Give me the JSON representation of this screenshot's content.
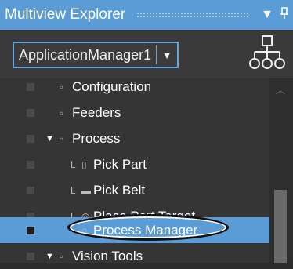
{
  "window": {
    "title": "Multiview Explorer",
    "dropdown_btn": "▼",
    "pin_btn": "ᵾ"
  },
  "toolbar": {
    "selector_value": "ApplicationManager1",
    "selector_arrow": "▼"
  },
  "tree": [
    {
      "label": "Configuration",
      "icon": "▫",
      "expander": "",
      "indent": 1
    },
    {
      "label": "Feeders",
      "icon": "▫",
      "expander": "",
      "indent": 1
    },
    {
      "label": "Process",
      "icon": "▫",
      "expander": "▼",
      "indent": 1
    },
    {
      "label": "Pick Part",
      "icon": "▯",
      "connector": "L",
      "indent": 2
    },
    {
      "label": "Pick Belt",
      "icon": "▬",
      "connector": "L",
      "indent": 2
    },
    {
      "label": "Place Part Target",
      "icon": "◎",
      "connector": "L",
      "indent": 2
    },
    {
      "label": "Process Manager",
      "icon": "◌",
      "selected": true,
      "indent": 2
    },
    {
      "label": "Vision Tools",
      "icon": "▫",
      "expander": "▼",
      "indent": 1
    }
  ],
  "colors": {
    "accent": "#5b9bd6",
    "background": "#353535",
    "highlight_border": "#111111"
  }
}
